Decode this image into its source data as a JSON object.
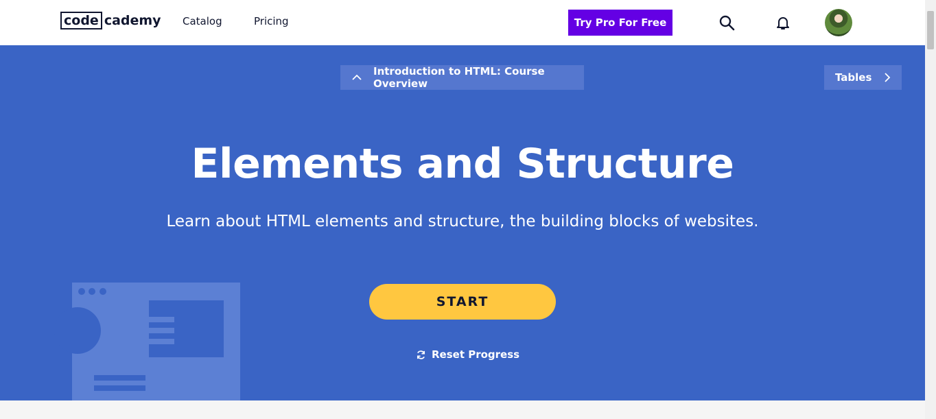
{
  "nav": {
    "logo_code": "code",
    "logo_rest": "cademy",
    "links": [
      "Catalog",
      "Pricing"
    ],
    "try_pro": "Try Pro For Free"
  },
  "hero": {
    "prev_lesson": "Introduction to HTML: Course Overview",
    "next_lesson": "Tables",
    "title": "Elements and Structure",
    "subtitle": "Learn about HTML elements and structure, the building blocks of websites.",
    "start": "START",
    "reset": "Reset Progress"
  },
  "colors": {
    "hero_bg": "#3a64c5",
    "pro_purple": "#6400e4",
    "start_yellow": "#ffc740"
  },
  "icons": [
    "search-icon",
    "bell-icon",
    "chevron-up-icon",
    "chevron-right-icon",
    "refresh-icon"
  ]
}
